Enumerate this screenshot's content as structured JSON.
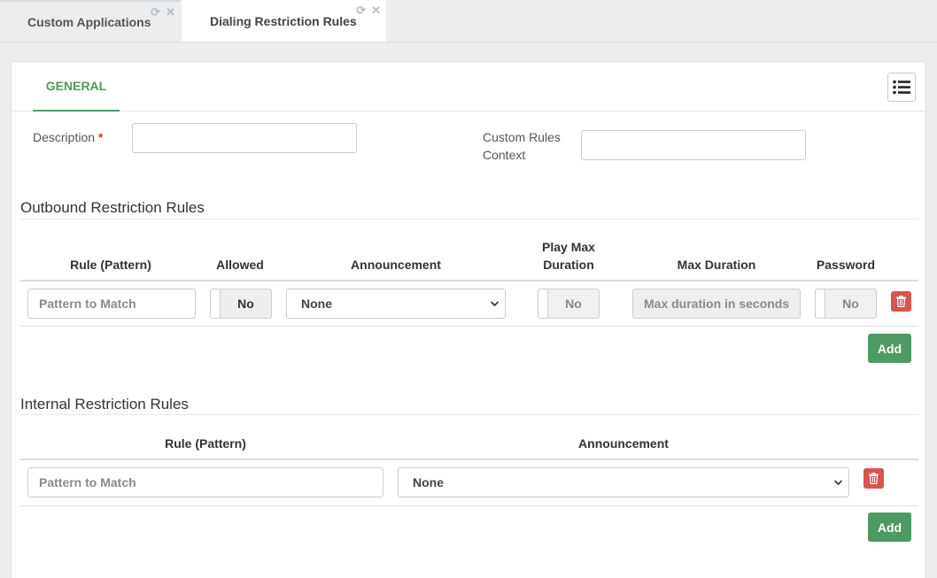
{
  "tabs": [
    {
      "label": "Custom Applications",
      "active": false
    },
    {
      "label": "Dialing Restriction Rules",
      "active": true
    }
  ],
  "tab_icons": {
    "refresh": "⟳",
    "close": "✕"
  },
  "panel": {
    "general_tab": "GENERAL",
    "list_button_icon": "list-icon"
  },
  "form": {
    "description_label": "Description",
    "required_marker": "*",
    "description_value": "",
    "custom_rules_label_line1": "Custom Rules",
    "custom_rules_label_line2": "Context",
    "custom_rules_value": ""
  },
  "outbound": {
    "title": "Outbound Restriction Rules",
    "headers": {
      "rule": "Rule (Pattern)",
      "allowed": "Allowed",
      "announcement": "Announcement",
      "play_max_line1": "Play Max",
      "play_max_line2": "Duration",
      "max_duration": "Max Duration",
      "password": "Password"
    },
    "row": {
      "pattern_placeholder": "Pattern to Match",
      "allowed": "No",
      "announcement": "None",
      "play_max": "No",
      "max_duration_placeholder": "Max duration in seconds",
      "password": "No"
    },
    "add_label": "Add"
  },
  "internal": {
    "title": "Internal Restriction Rules",
    "headers": {
      "rule": "Rule (Pattern)",
      "announcement": "Announcement"
    },
    "row": {
      "pattern_placeholder": "Pattern to Match",
      "announcement": "None"
    },
    "add_label": "Add"
  },
  "colors": {
    "accent_green": "#4e9a64",
    "danger_red": "#d9534f"
  }
}
